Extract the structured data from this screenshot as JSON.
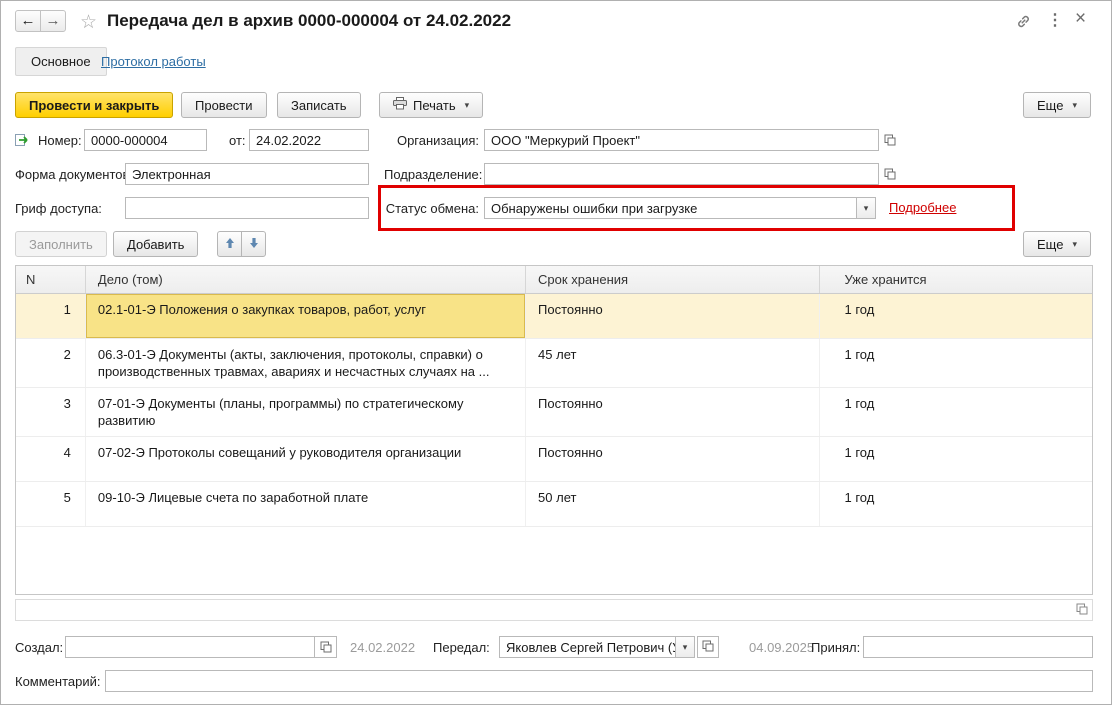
{
  "titlebar": {
    "title": "Передача дел в архив 0000-000004 от 24.02.2022"
  },
  "icons": {
    "back": "←",
    "forward": "→",
    "star": "☆",
    "menu_dots": "⋮",
    "close": "×",
    "dropdown": "▾"
  },
  "tabs": {
    "main": "Основное",
    "protocol": "Протокол работы"
  },
  "toolbar": {
    "post_and_close": "Провести и закрыть",
    "post": "Провести",
    "write": "Записать",
    "print": "Печать",
    "more": "Еще"
  },
  "fields": {
    "number_label": "Номер:",
    "number_value": "0000-000004",
    "date_label": "от:",
    "date_value": "24.02.2022",
    "org_label": "Организация:",
    "org_value": "ООО \"Меркурий Проект\"",
    "doc_form_label": "Форма документов:",
    "doc_form_value": "Электронная",
    "division_label": "Подразделение:",
    "division_value": "",
    "access_label": "Гриф доступа:",
    "access_value": "",
    "status_label": "Статус обмена:",
    "status_value": "Обнаружены ошибки при загрузке",
    "details_link": "Подробнее"
  },
  "table_toolbar": {
    "fill": "Заполнить",
    "add": "Добавить",
    "more": "Еще"
  },
  "table": {
    "headers": {
      "n": "N",
      "case": "Дело (том)",
      "period": "Срок хранения",
      "stored": "Уже хранится"
    },
    "rows": [
      {
        "n": "1",
        "case": "02.1-01-Э Положения о закупках товаров, работ, услуг",
        "period": "Постоянно",
        "stored": "1 год"
      },
      {
        "n": "2",
        "case": "06.3-01-Э Документы (акты, заключения, протоколы, справки) о производственных травмах, авариях и несчастных случаях на ...",
        "period": "45 лет",
        "stored": "1 год"
      },
      {
        "n": "3",
        "case": "07-01-Э Документы (планы, программы) по стратегическому развитию",
        "period": "Постоянно",
        "stored": "1 год"
      },
      {
        "n": "4",
        "case": "07-02-Э Протоколы совещаний у руководителя организации",
        "period": "Постоянно",
        "stored": "1 год"
      },
      {
        "n": "5",
        "case": "09-10-Э Лицевые счета по заработной плате",
        "period": "50 лет",
        "stored": "1 год"
      }
    ]
  },
  "footer": {
    "created_label": "Создал:",
    "created_value": "",
    "created_date": "24.02.2022",
    "transferred_label": "Передал:",
    "transferred_value": "Яковлев Сергей Петрович (Упра",
    "transferred_date": "04.09.2025",
    "accepted_label": "Принял:",
    "accepted_value": "",
    "comment_label": "Комментарий:",
    "comment_value": ""
  },
  "colors": {
    "highlight_frame": "#e00000",
    "primary_button_yellow": "#ffd400",
    "selected_row": "#fdf3d4",
    "selected_cell": "#f8e387",
    "link_blue": "#2d6da3",
    "error_link_red": "#d00000"
  }
}
